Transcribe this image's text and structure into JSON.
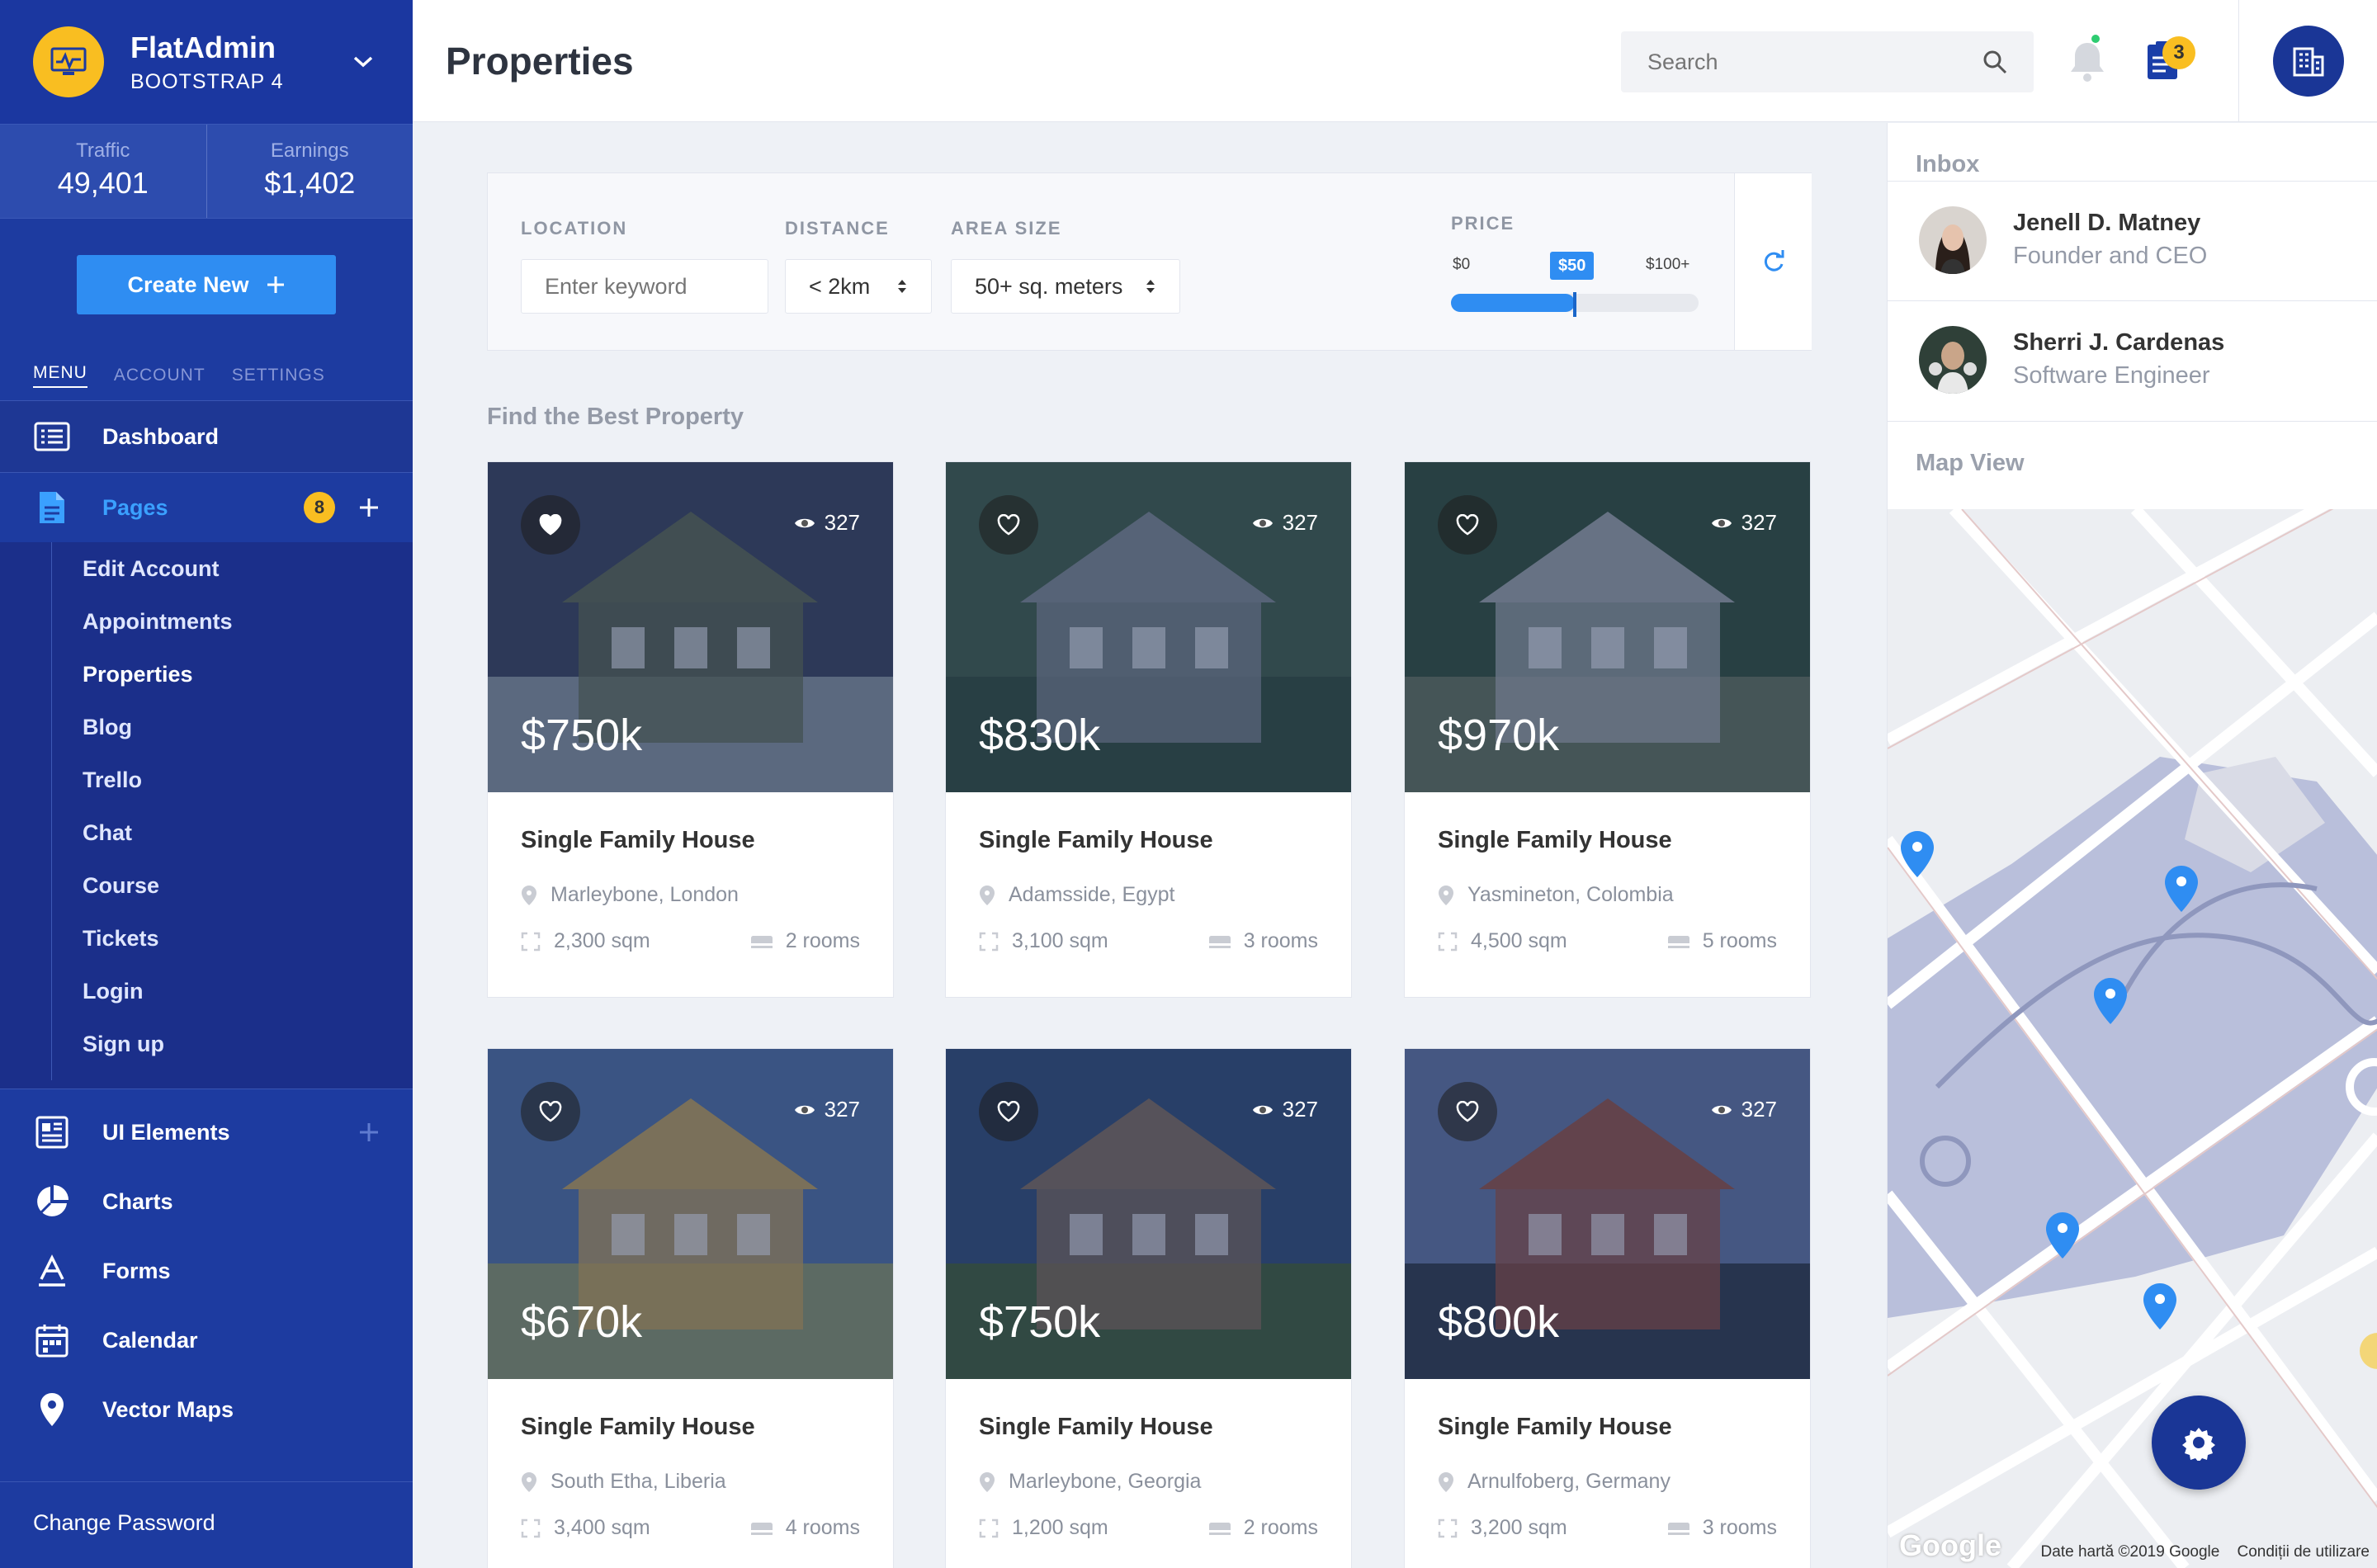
{
  "brand": {
    "name": "FlatAdmin",
    "subtitle": "BOOTSTRAP 4"
  },
  "stats": [
    {
      "label": "Traffic",
      "value": "49,401"
    },
    {
      "label": "Earnings",
      "value": "$1,402"
    }
  ],
  "create_button": "Create New",
  "menu_tabs": [
    "MENU",
    "ACCOUNT",
    "SETTINGS"
  ],
  "nav": {
    "dashboard": "Dashboard",
    "pages": {
      "label": "Pages",
      "badge": "8"
    },
    "subpages": [
      "Edit Account",
      "Appointments",
      "Properties",
      "Blog",
      "Trello",
      "Chat",
      "Course",
      "Tickets",
      "Login",
      "Sign up"
    ],
    "ui_elements": "UI Elements",
    "charts": "Charts",
    "forms": "Forms",
    "calendar": "Calendar",
    "vector_maps": "Vector Maps",
    "change_password": "Change Password"
  },
  "header": {
    "title": "Properties",
    "search_placeholder": "Search",
    "tasks_badge": "3"
  },
  "filters": {
    "location_label": "LOCATION",
    "location_placeholder": "Enter keyword",
    "distance_label": "DISTANCE",
    "distance_value": "< 2km",
    "area_label": "AREA SIZE",
    "area_value": "50+ sq. meters",
    "price_label": "PRICE",
    "price_min": "$0",
    "price_current": "$50",
    "price_max": "$100+",
    "price_fraction": 0.5
  },
  "section_title": "Find the Best Property",
  "properties": [
    {
      "price": "$750k",
      "views": "327",
      "title": "Single Family House",
      "location": "Marleybone, London",
      "area": "2,300 sqm",
      "rooms": "2 rooms"
    },
    {
      "price": "$830k",
      "views": "327",
      "title": "Single Family House",
      "location": "Adamsside, Egypt",
      "area": "3,100 sqm",
      "rooms": "3 rooms"
    },
    {
      "price": "$970k",
      "views": "327",
      "title": "Single Family House",
      "location": "Yasmineton, Colombia",
      "area": "4,500 sqm",
      "rooms": "5 rooms"
    },
    {
      "price": "$670k",
      "views": "327",
      "title": "Single Family House",
      "location": "South Etha, Liberia",
      "area": "3,400 sqm",
      "rooms": "4 rooms"
    },
    {
      "price": "$750k",
      "views": "327",
      "title": "Single Family House",
      "location": "Marleybone, Georgia",
      "area": "1,200 sqm",
      "rooms": "2 rooms"
    },
    {
      "price": "$800k",
      "views": "327",
      "title": "Single Family House",
      "location": "Arnulfoberg, Germany",
      "area": "3,200 sqm",
      "rooms": "3 rooms"
    }
  ],
  "inbox": {
    "title": "Inbox",
    "contacts": [
      {
        "name": "Jenell D. Matney",
        "role": "Founder and CEO"
      },
      {
        "name": "Sherri J. Cardenas",
        "role": "Software Engineer"
      }
    ]
  },
  "map": {
    "title": "Map View",
    "logo": "Google",
    "attribution": "Date hartă ©2019 Google",
    "terms": "Condiții de utilizare"
  },
  "colors": {
    "sidebar": "#1d3ba0",
    "accent": "#2f8df2",
    "badge": "#f9be21",
    "dark_button": "#1a3696"
  }
}
